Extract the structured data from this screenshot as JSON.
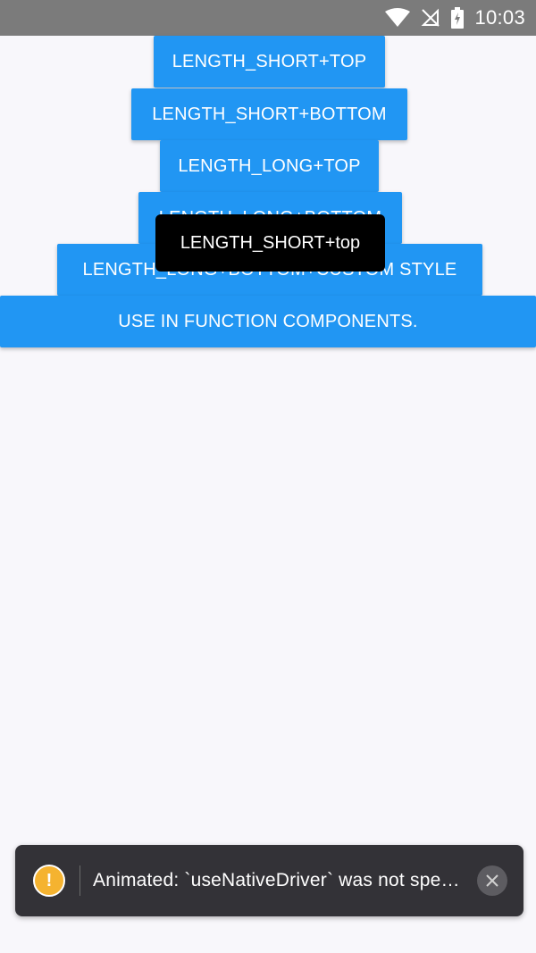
{
  "status_bar": {
    "time": "10:03",
    "icons": [
      "wifi-icon",
      "no-signal-icon",
      "battery-charging-icon"
    ]
  },
  "buttons": [
    {
      "label": "LENGTH_SHORT+TOP"
    },
    {
      "label": "LENGTH_SHORT+BOTTOM"
    },
    {
      "label": "LENGTH_LONG+TOP"
    },
    {
      "label": "LENGTH_LONG+BOTTOM"
    },
    {
      "label": "LENGTH_LONG+BOTTOM+CUSTOM STYLE"
    },
    {
      "label": "USE IN FUNCTION COMPONENTS."
    }
  ],
  "toast": {
    "text": "LENGTH_SHORT+top"
  },
  "logbox": {
    "message": "Animated: `useNativeDriver` was not specified.",
    "warning_icon": "warning-icon",
    "close_icon": "close-icon"
  },
  "colors": {
    "button": "#2196f3",
    "status_bar": "#7b7b7b",
    "toast": "#000000",
    "logbox": "#333237",
    "warning": "#f5b330"
  }
}
